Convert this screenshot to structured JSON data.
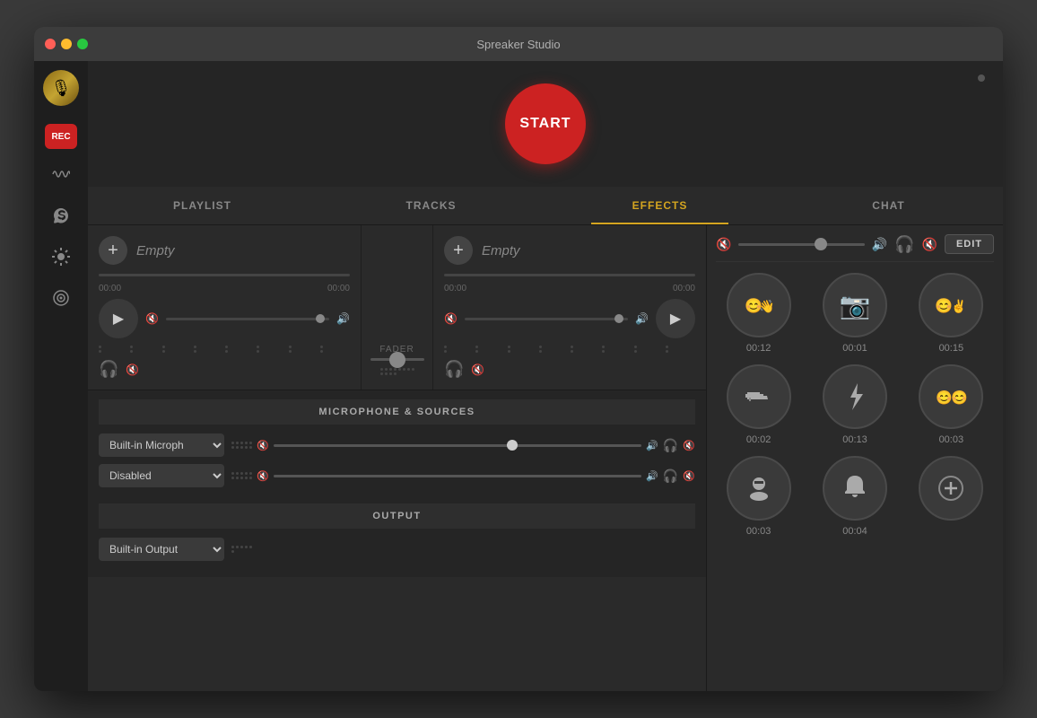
{
  "app": {
    "title": "Spreaker Studio"
  },
  "titlebar": {
    "title": "Spreaker Studio"
  },
  "start_button": {
    "label": "START"
  },
  "tabs": [
    {
      "id": "playlist",
      "label": "PLAYLIST",
      "active": false
    },
    {
      "id": "tracks",
      "label": "TRACKS",
      "active": true
    },
    {
      "id": "effects",
      "label": "EFFECTS",
      "active": false
    },
    {
      "id": "chat",
      "label": "CHAT",
      "active": false
    }
  ],
  "tracks": [
    {
      "name": "Empty",
      "time_start": "00:00",
      "time_end": "00:00"
    },
    {
      "name": "Empty",
      "time_start": "00:00",
      "time_end": "00:00"
    }
  ],
  "fader": {
    "label": "FADER"
  },
  "microphone_section": {
    "label": "MICROPHONE & SOURCES",
    "sources": [
      {
        "value": "builtin",
        "label": "Built-in Microph"
      },
      {
        "value": "disabled",
        "label": "Disabled"
      }
    ]
  },
  "output_section": {
    "label": "OUTPUT",
    "output": "Built-in Output"
  },
  "effects": {
    "edit_label": "EDIT",
    "buttons": [
      {
        "id": "effect-1",
        "icon": "😊👋",
        "time": "00:12"
      },
      {
        "id": "effect-2",
        "icon": "📷",
        "time": "00:01"
      },
      {
        "id": "effect-3",
        "icon": "😊✌",
        "time": "00:15"
      },
      {
        "id": "effect-4",
        "icon": "🔫",
        "time": "00:02"
      },
      {
        "id": "effect-5",
        "icon": "⚡",
        "time": "00:13"
      },
      {
        "id": "effect-6",
        "icon": "😊😊",
        "time": "00:03"
      },
      {
        "id": "effect-7",
        "icon": "🕵",
        "time": "00:03"
      },
      {
        "id": "effect-8",
        "icon": "🔔",
        "time": "00:04"
      },
      {
        "id": "effect-9",
        "icon": "➕",
        "time": ""
      }
    ]
  },
  "sidebar": {
    "rec_label": "REC",
    "icons": [
      {
        "id": "waveform",
        "symbol": "〜"
      },
      {
        "id": "skype",
        "symbol": "S"
      },
      {
        "id": "settings",
        "symbol": "⚙"
      },
      {
        "id": "target",
        "symbol": "◎"
      }
    ]
  }
}
